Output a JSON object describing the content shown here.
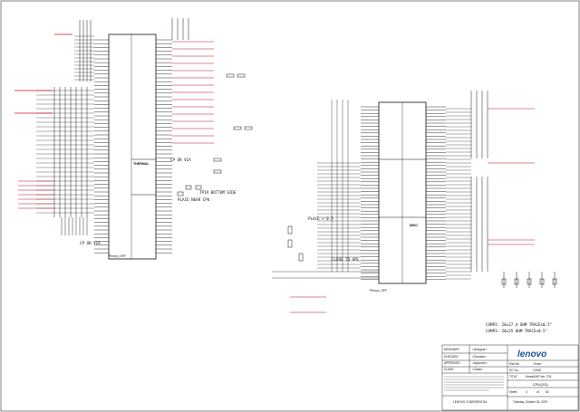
{
  "notes": {
    "cp_via_1": "CP OR VIA",
    "cp_via_2": "CP OR VIA",
    "tp19_bottom": "TP19 BOTTOM SIDE",
    "place_near_cpu": "PLACE NEAR CPU",
    "close_to_apl": "CLOSE TO APL",
    "place_lt": "PLACE < 0.5",
    "comp2": "COMP2: 20=27.4 OHM TRACE<0.5\"",
    "comp3": "COMP3: 20=55 OHM TRACE<0.5\"",
    "thermal": "THERMAL",
    "misc": "MISC",
    "penryn_left": "Penryn_SFF",
    "penryn_right": "Penryn_SFF"
  },
  "title_block": {
    "designer_label": "DESIGNER",
    "designer_value": "<Designer>",
    "checked_label": "CHECKED",
    "checked_value": "<Checker>",
    "approved_label": "APPROVED",
    "approved_value": "<Approver>",
    "class_label": "CLASS",
    "class_value": "<Class>",
    "brand": "lenovo",
    "part_label": "Part No.",
    "part_value": "<Part>",
    "doc_label": "DC No.",
    "doc_value": "12345",
    "title_label": "TITLE",
    "title_value": "Kenia/KAR Ver. 70V",
    "sheet_title": "CPU(2/3)",
    "sheet_label": "Sheet",
    "sheet_num": "3",
    "of_label": "of",
    "sheet_total": "60",
    "date": "Tuesday, October 30, 2007",
    "confidential": "LENOVO CONFIDENTIAL"
  },
  "colors": {
    "line": "#1a1a1a",
    "net_red": "#c0102a",
    "frame": "#333333",
    "logo_blue": "#1a4fa0"
  }
}
